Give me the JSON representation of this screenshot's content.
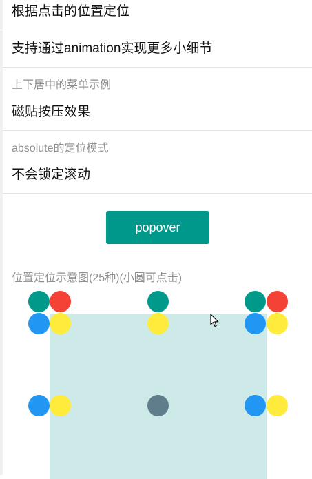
{
  "menu": {
    "item_click_position": "根据点击的位置定位",
    "item_animation": "支持通过animation实现更多小细节",
    "section_center_title": "上下居中的菜单示例",
    "item_tile_press": "磁贴按压效果",
    "section_absolute_title": "absolute的定位模式",
    "item_no_scroll_lock": "不会锁定滚动"
  },
  "popover_button": {
    "label": "popover"
  },
  "diagram": {
    "title": "位置定位示意图(25种)(小圆可点击)"
  },
  "colors": {
    "teal": "#00998a",
    "red": "#f44336",
    "blue": "#2196f3",
    "yellow": "#ffeb3b",
    "slate": "#607d8b",
    "button": "#00988a",
    "target_box": "#cdeae9"
  }
}
